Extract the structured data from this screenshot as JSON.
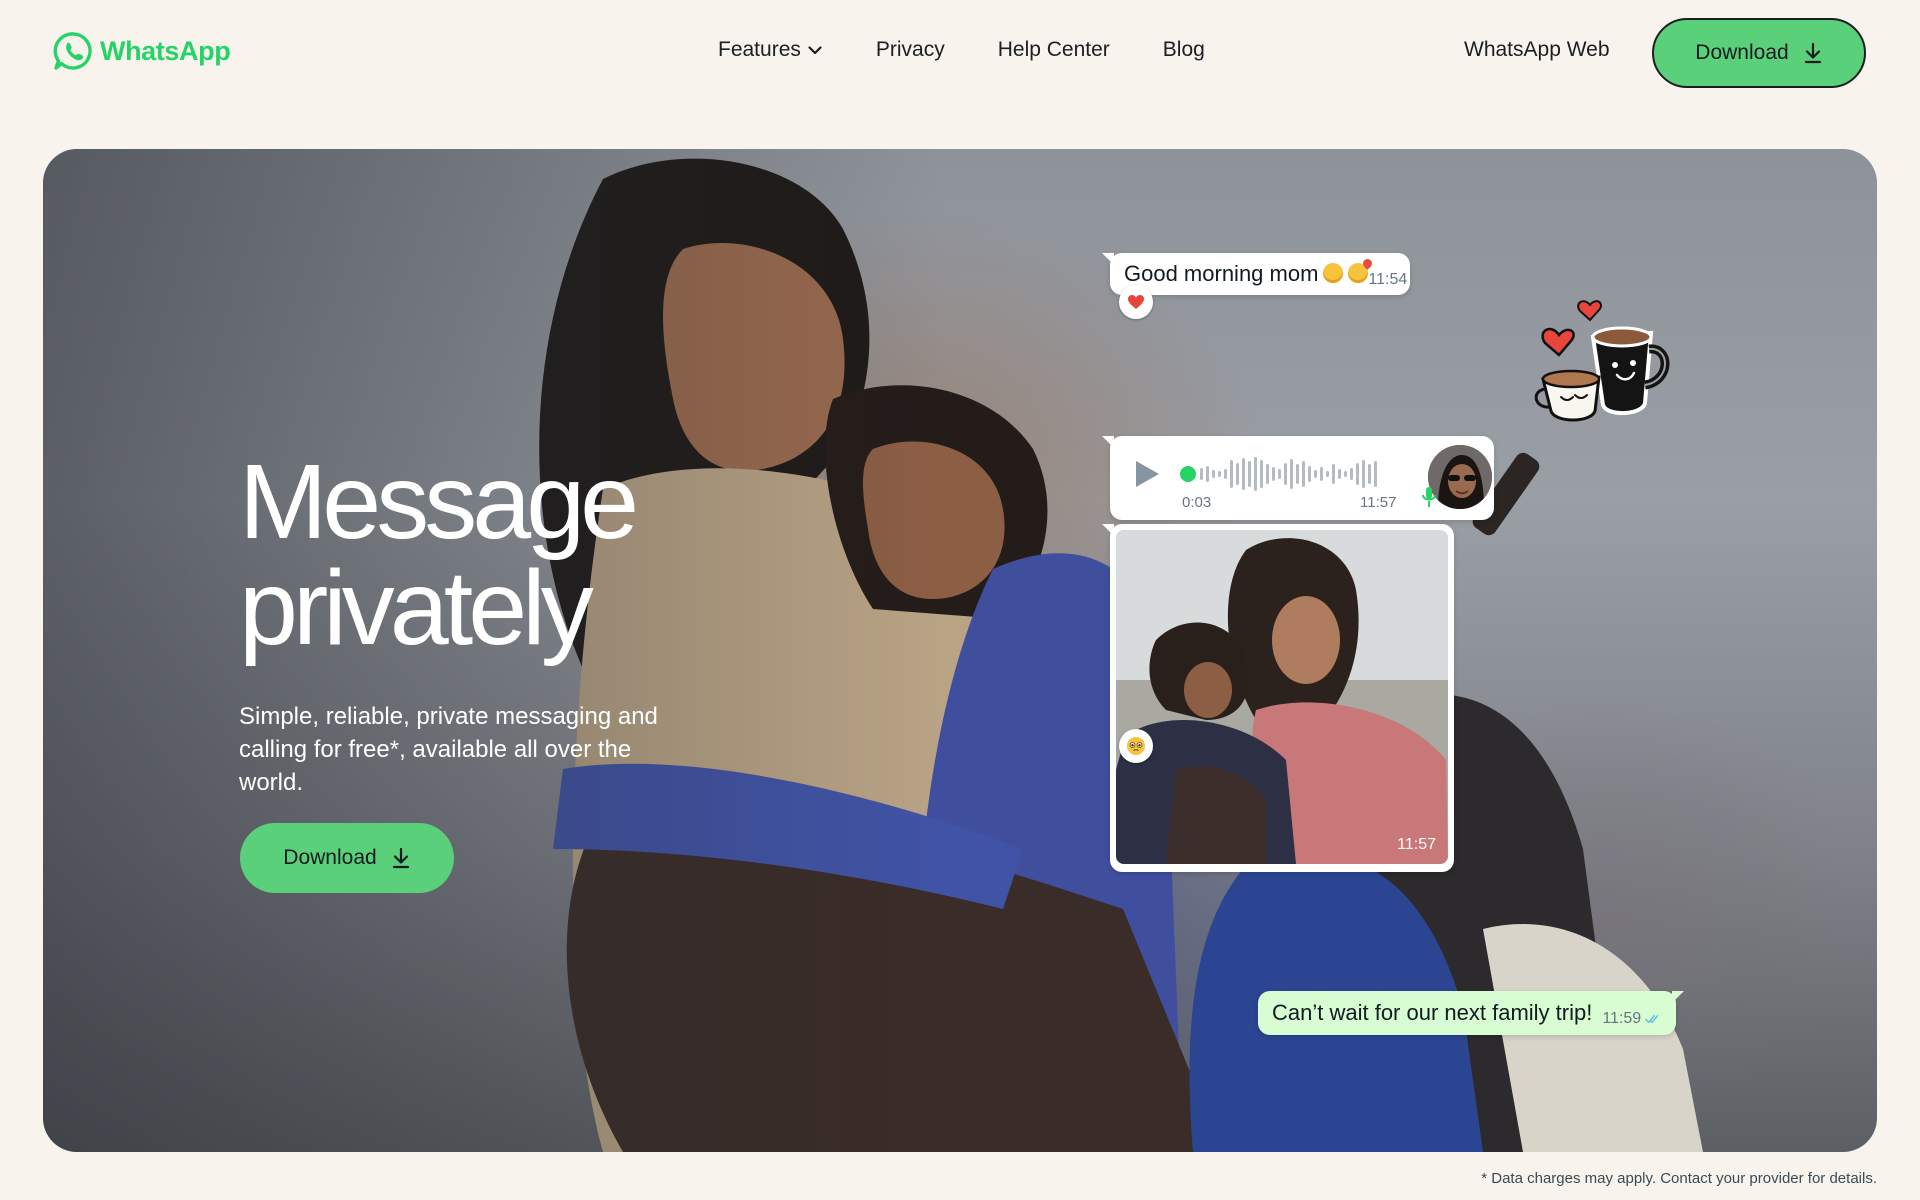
{
  "header": {
    "logo_text": "WhatsApp",
    "nav": [
      {
        "label": "Features",
        "icon": "chevron-down-icon"
      },
      {
        "label": "Privacy"
      },
      {
        "label": "Help Center"
      },
      {
        "label": "Blog"
      }
    ],
    "web_link": "WhatsApp Web",
    "download_label": "Download"
  },
  "hero": {
    "title_line1": "Message",
    "title_line2": "privately",
    "subtitle": "Simple, reliable, private messaging and calling for free*, available all over the world.",
    "download_label": "Download"
  },
  "chat": {
    "message1": {
      "text": "Good morning mom",
      "time": "11:54",
      "reaction": "heart"
    },
    "voice": {
      "duration": "0:03",
      "time": "11:57"
    },
    "photo": {
      "time": "11:57",
      "reaction": "teary-face"
    },
    "message2": {
      "text": "Can’t wait for our next family trip!",
      "time": "11:59",
      "status": "read"
    }
  },
  "footnote": "* Data charges may apply. Contact your provider for details.",
  "colors": {
    "brand_green": "#25d366",
    "button_green": "#5bd07a",
    "background": "#f8f4ed",
    "outgoing_bubble": "#d9fdd3"
  }
}
